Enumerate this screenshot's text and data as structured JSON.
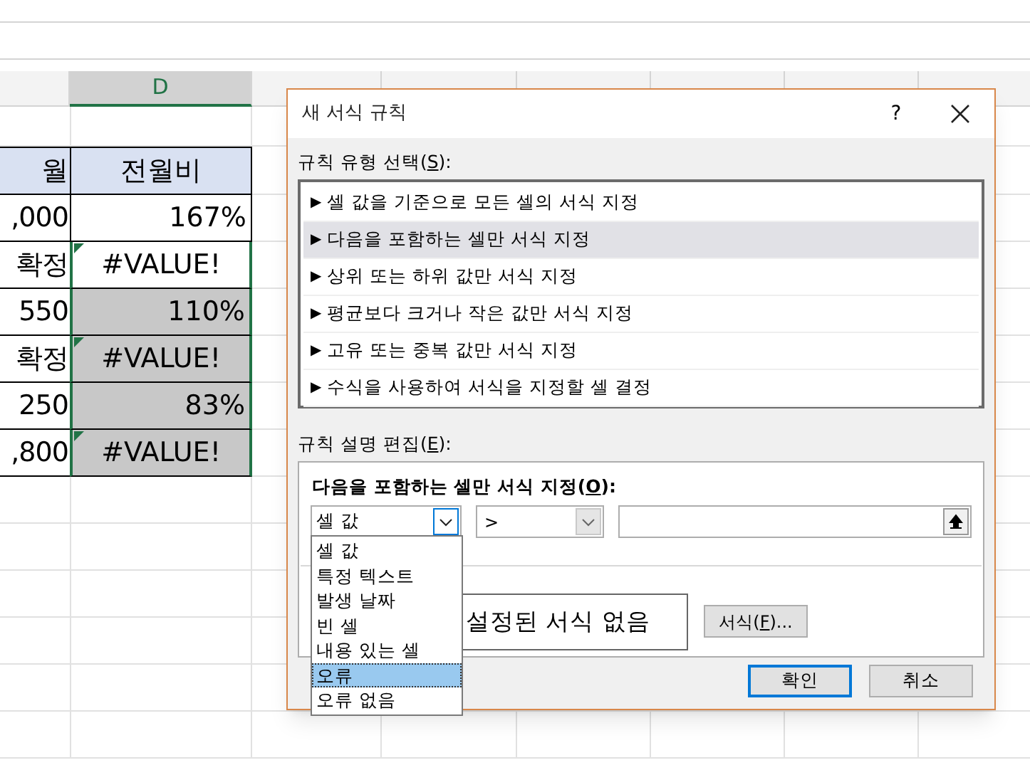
{
  "sheet": {
    "column_headers": [
      {
        "label": "D",
        "selected": true
      }
    ],
    "rows": [
      {
        "kind": "blank"
      },
      {
        "kind": "header",
        "c": "월",
        "d": "전월비"
      },
      {
        "kind": "data",
        "c": ",000",
        "d": "167%",
        "shaded": false,
        "error_flag": false,
        "in_selection": false
      },
      {
        "kind": "data",
        "c": "확정",
        "d": "#VALUE!",
        "shaded": false,
        "error_flag": true,
        "in_selection": true
      },
      {
        "kind": "data",
        "c": "550",
        "d": "110%",
        "shaded": true,
        "error_flag": false,
        "in_selection": true
      },
      {
        "kind": "data",
        "c": "확정",
        "d": "#VALUE!",
        "shaded": true,
        "error_flag": true,
        "in_selection": true
      },
      {
        "kind": "data",
        "c": "250",
        "d": "83%",
        "shaded": true,
        "error_flag": false,
        "in_selection": true
      },
      {
        "kind": "data",
        "c": ",800",
        "d": "#VALUE!",
        "shaded": true,
        "error_flag": true,
        "in_selection": true
      }
    ]
  },
  "dialog": {
    "title": "새 서식 규칙",
    "help": "?",
    "rule_type_label": [
      "규칙 유형 선택(",
      "S",
      "):"
    ],
    "rule_types": [
      {
        "label": "셀 값을 기준으로 모든 셀의 서식 지정",
        "selected": false
      },
      {
        "label": "다음을 포함하는 셀만 서식 지정",
        "selected": true
      },
      {
        "label": "상위 또는 하위 값만 서식 지정",
        "selected": false
      },
      {
        "label": "평균보다 크거나 작은 값만 서식 지정",
        "selected": false
      },
      {
        "label": "고유 또는 중복 값만 서식 지정",
        "selected": false
      },
      {
        "label": "수식을 사용하여 서식을 지정할 셀 결정",
        "selected": false
      }
    ],
    "marker": "▶",
    "edit_label": [
      "규칙 설명 편집(",
      "E",
      "):"
    ],
    "edit_heading": [
      "다음을 포함하는 셀만 서식 지정(",
      "O",
      "):"
    ],
    "condition_type": "셀 값",
    "operator": ">",
    "condition_options": [
      {
        "label": "셀 값",
        "selected": false
      },
      {
        "label": "특정 텍스트",
        "selected": false
      },
      {
        "label": "발생 날짜",
        "selected": false
      },
      {
        "label": "빈 셀",
        "selected": false
      },
      {
        "label": "내용 있는 셀",
        "selected": false
      },
      {
        "label": "오류",
        "selected": true
      },
      {
        "label": "오류 없음",
        "selected": false
      }
    ],
    "preview": "설정된 서식 없음",
    "format_button": [
      "서식(",
      "F",
      ")..."
    ],
    "ok": "확인",
    "cancel": "취소"
  }
}
